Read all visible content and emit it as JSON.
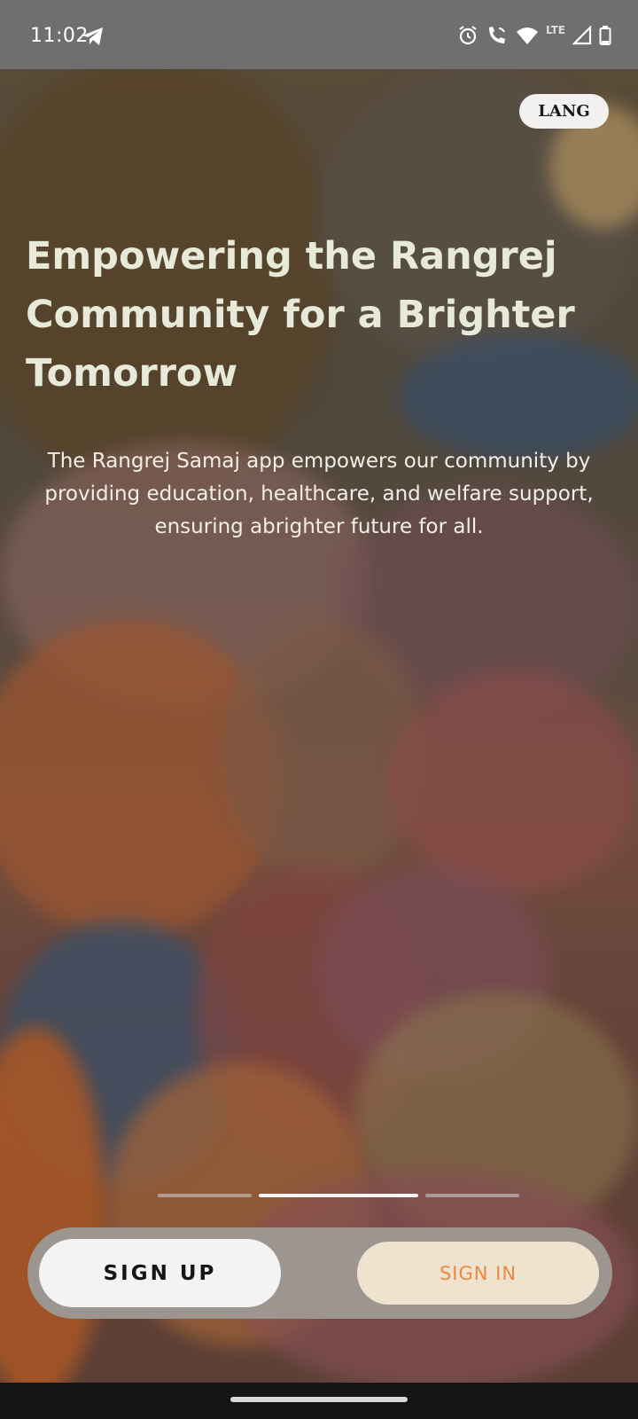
{
  "status": {
    "time": "11:02",
    "network": "LTE"
  },
  "lang_label": "LANG",
  "hero": {
    "title": "Empowering the Rangrej Community for a Brighter Tomorrow",
    "description": "The Rangrej Samaj app empowers our community by providing education, healthcare, and welfare support, ensuring abrighter future for all."
  },
  "pager": {
    "count": 3,
    "active_index": 1
  },
  "auth": {
    "signup_label": "SIGN UP",
    "signin_label": "SIGN IN"
  },
  "colors": {
    "title": "#e7ead9",
    "signin_text": "#e58a42",
    "signin_bg": "#efe3cf",
    "status_bar": "#6f6f6f"
  }
}
